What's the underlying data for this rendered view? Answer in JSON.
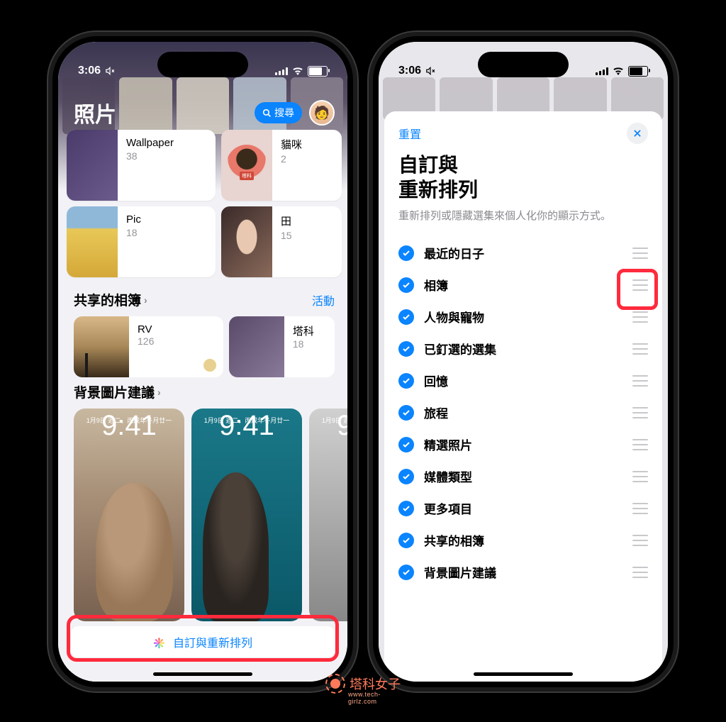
{
  "status": {
    "time": "3:06"
  },
  "left": {
    "app_title": "照片",
    "search_label": "搜尋",
    "albums_row1": [
      {
        "name": "Wallpaper",
        "count": "38"
      },
      {
        "name": "貓咪",
        "count": "2"
      }
    ],
    "albums_row2": [
      {
        "name": "Pic",
        "count": "18"
      },
      {
        "name": "田",
        "count": "15"
      }
    ],
    "shared": {
      "title": "共享的相簿",
      "link": "活動",
      "items": [
        {
          "name": "RV",
          "count": "126"
        },
        {
          "name": "塔科",
          "count": "18"
        }
      ]
    },
    "wallpapers": {
      "title": "背景圖片建議",
      "preview_date": "1月9日 週二，丙戌年冬月廿一",
      "preview_time": "9:41"
    },
    "customize_button": "自訂與重新排列"
  },
  "right": {
    "reset": "重置",
    "title_line1": "自訂與",
    "title_line2": "重新排列",
    "desc": "重新排列或隱藏選集來個人化你的顯示方式。",
    "items": [
      "最近的日子",
      "相簿",
      "人物與寵物",
      "已釘選的選集",
      "回憶",
      "旅程",
      "精選照片",
      "媒體類型",
      "更多項目",
      "共享的相簿",
      "背景圖片建議"
    ]
  },
  "watermark": {
    "text": "塔科女子",
    "sub": "www.tech-girlz.com"
  }
}
